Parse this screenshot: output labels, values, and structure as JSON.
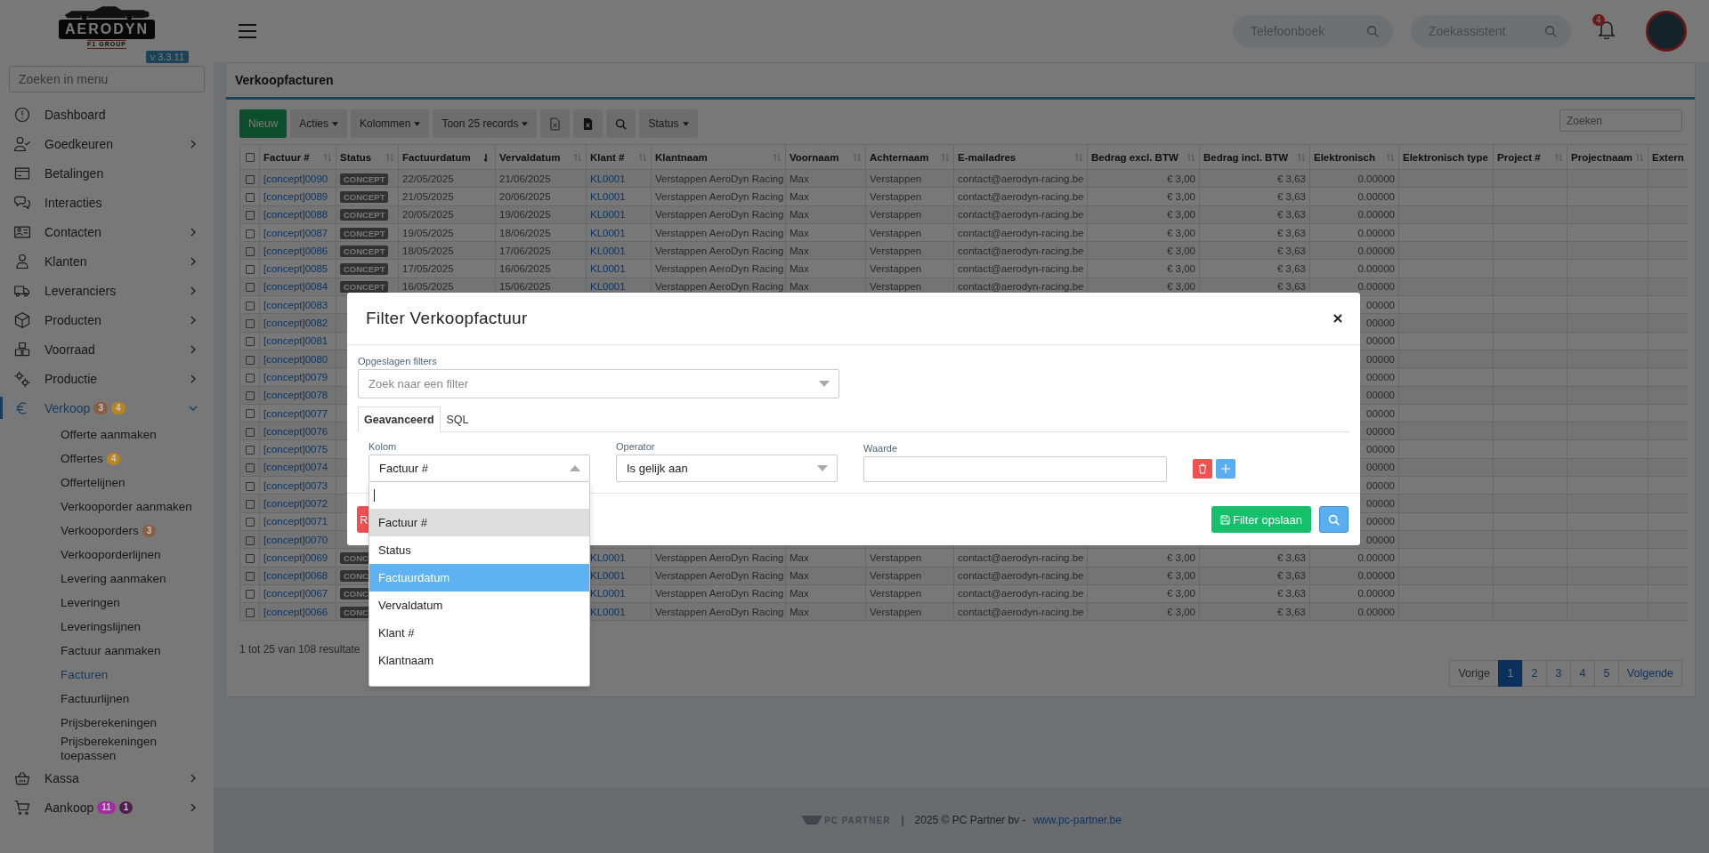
{
  "sidebar": {
    "logo": {
      "name": "AERODYN",
      "tagline": "F1 GROUP"
    },
    "version": "v 3.3.11",
    "search": {
      "placeholder": "Zoeken in menu"
    },
    "items": [
      {
        "label": "Dashboard",
        "selected": false
      },
      {
        "label": "Goedkeuren",
        "expanded": false,
        "selected": false
      },
      {
        "label": "Betalingen",
        "selected": false
      },
      {
        "label": "Interacties",
        "selected": false
      },
      {
        "label": "Contacten",
        "expanded": false,
        "selected": false
      },
      {
        "label": "Klanten",
        "expanded": false,
        "selected": false
      },
      {
        "label": "Leveranciers",
        "expanded": false,
        "selected": false
      },
      {
        "label": "Producten",
        "expanded": false,
        "selected": false
      },
      {
        "label": "Voorraad",
        "expanded": false,
        "selected": false
      },
      {
        "label": "Productie",
        "expanded": false,
        "selected": false
      },
      {
        "label": "Verkoop",
        "expanded": true,
        "selected": true,
        "badges": [
          {
            "text": "3",
            "color": "#8a5e44"
          },
          {
            "text": "4",
            "color": "#b8861e"
          }
        ],
        "children": [
          {
            "label": "Offerte aanmaken",
            "selected": false
          },
          {
            "label": "Offertes",
            "selected": false,
            "badges": [
              {
                "text": "4",
                "color": "#b8861e"
              }
            ]
          },
          {
            "label": "Offertelijnen",
            "selected": false
          },
          {
            "label": "Verkooporder aanmaken",
            "selected": false
          },
          {
            "label": "Verkooporders",
            "selected": false,
            "badges": [
              {
                "text": "3",
                "color": "#8a5e44"
              }
            ]
          },
          {
            "label": "Verkooporderlijnen",
            "selected": false
          },
          {
            "label": "Levering aanmaken",
            "selected": false
          },
          {
            "label": "Leveringen",
            "selected": false
          },
          {
            "label": "Leveringslijnen",
            "selected": false
          },
          {
            "label": "Factuur aanmaken",
            "selected": false
          },
          {
            "label": "Facturen",
            "selected": true
          },
          {
            "label": "Factuurlijnen",
            "selected": false
          },
          {
            "label": "Prijsberekeningen",
            "selected": false
          },
          {
            "label": "Prijsberekeningen toepassen",
            "selected": false
          }
        ]
      },
      {
        "label": "Kassa",
        "expanded": false,
        "selected": false
      },
      {
        "label": "Aankoop",
        "expanded": false,
        "selected": false,
        "badges": [
          {
            "text": "11",
            "color": "#a32ca3"
          },
          {
            "text": "1",
            "color": "#4d1f4d"
          }
        ]
      }
    ]
  },
  "topbar": {
    "phonebook": {
      "placeholder": "Telefoonboek"
    },
    "assistant": {
      "placeholder": "Zoekassistent"
    },
    "notifications": {
      "count": "4"
    }
  },
  "card": {
    "title": "Verkoopfacturen",
    "toolbar": [
      {
        "kind": "primary",
        "label": "Nieuw"
      },
      {
        "kind": "dropdown",
        "label": "Acties"
      },
      {
        "kind": "dropdown",
        "label": "Kolommen"
      },
      {
        "kind": "dropdown",
        "label": "Toon 25 records"
      },
      {
        "kind": "excel"
      },
      {
        "kind": "export"
      },
      {
        "kind": "search"
      },
      {
        "kind": "dropdown",
        "label": "Status"
      }
    ],
    "search": {
      "placeholder": "Zoeken"
    },
    "table": {
      "select_all_checked": false,
      "columns": [
        {
          "label": "Factuur #",
          "sortable": true,
          "sorted": false,
          "kind": "link"
        },
        {
          "label": "Status",
          "sortable": true,
          "sorted": false,
          "kind": "badge"
        },
        {
          "label": "Factuurdatum",
          "sortable": true,
          "sorted": true,
          "kind": "text"
        },
        {
          "label": "Vervaldatum",
          "sortable": true,
          "sorted": false,
          "kind": "text"
        },
        {
          "label": "Klant #",
          "sortable": true,
          "sorted": false,
          "kind": "link"
        },
        {
          "label": "Klantnaam",
          "sortable": true,
          "sorted": false,
          "kind": "text"
        },
        {
          "label": "Voornaam",
          "sortable": true,
          "sorted": false,
          "kind": "text"
        },
        {
          "label": "Achternaam",
          "sortable": true,
          "sorted": false,
          "kind": "text"
        },
        {
          "label": "E-mailadres",
          "sortable": true,
          "sorted": false,
          "kind": "text"
        },
        {
          "label": "Bedrag excl. BTW",
          "sortable": true,
          "sorted": false,
          "kind": "number"
        },
        {
          "label": "Bedrag incl. BTW",
          "sortable": true,
          "sorted": false,
          "kind": "number"
        },
        {
          "label": "Elektronisch",
          "sortable": true,
          "sorted": false,
          "kind": "number"
        },
        {
          "label": "Elektronisch type",
          "sortable": false,
          "kind": "text"
        },
        {
          "label": "Project #",
          "sortable": true,
          "sorted": false,
          "kind": "text"
        },
        {
          "label": "Projectnaam",
          "sortable": true,
          "sorted": false,
          "kind": "text"
        },
        {
          "label": "Extern",
          "sortable": false,
          "kind": "text"
        }
      ],
      "rows": [
        {
          "checked": false,
          "nr": "[concept]0090",
          "status": "CONCEPT",
          "datum": "22/05/2025",
          "verval": "21/06/2025",
          "klant": "KL0001",
          "naam": "Verstappen AeroDyn Racing",
          "voornaam": "Max",
          "achternaam": "Verstappen",
          "email": "contact@aerodyn-racing.be",
          "excl": "€ 3,00",
          "incl": "€ 3,63",
          "elek": "0.00000"
        },
        {
          "checked": false,
          "nr": "[concept]0089",
          "status": "CONCEPT",
          "datum": "21/05/2025",
          "verval": "20/06/2025",
          "klant": "KL0001",
          "naam": "Verstappen AeroDyn Racing",
          "voornaam": "Max",
          "achternaam": "Verstappen",
          "email": "contact@aerodyn-racing.be",
          "excl": "€ 3,00",
          "incl": "€ 3,63",
          "elek": "0.00000"
        },
        {
          "checked": false,
          "nr": "[concept]0088",
          "status": "CONCEPT",
          "datum": "20/05/2025",
          "verval": "19/06/2025",
          "klant": "KL0001",
          "naam": "Verstappen AeroDyn Racing",
          "voornaam": "Max",
          "achternaam": "Verstappen",
          "email": "contact@aerodyn-racing.be",
          "excl": "€ 3,00",
          "incl": "€ 3,63",
          "elek": "0.00000"
        },
        {
          "checked": false,
          "nr": "[concept]0087",
          "status": "CONCEPT",
          "datum": "19/05/2025",
          "verval": "18/06/2025",
          "klant": "KL0001",
          "naam": "Verstappen AeroDyn Racing",
          "voornaam": "Max",
          "achternaam": "Verstappen",
          "email": "contact@aerodyn-racing.be",
          "excl": "€ 3,00",
          "incl": "€ 3,63",
          "elek": "0.00000"
        },
        {
          "checked": false,
          "nr": "[concept]0086",
          "status": "CONCEPT",
          "datum": "18/05/2025",
          "verval": "17/06/2025",
          "klant": "KL0001",
          "naam": "Verstappen AeroDyn Racing",
          "voornaam": "Max",
          "achternaam": "Verstappen",
          "email": "contact@aerodyn-racing.be",
          "excl": "€ 3,00",
          "incl": "€ 3,63",
          "elek": "0.00000"
        },
        {
          "checked": false,
          "nr": "[concept]0085",
          "status": "CONCEPT",
          "datum": "17/05/2025",
          "verval": "16/06/2025",
          "klant": "KL0001",
          "naam": "Verstappen AeroDyn Racing",
          "voornaam": "Max",
          "achternaam": "Verstappen",
          "email": "contact@aerodyn-racing.be",
          "excl": "€ 3,00",
          "incl": "€ 3,63",
          "elek": "0.00000"
        },
        {
          "checked": false,
          "nr": "[concept]0084",
          "status": "CONCEPT",
          "datum": "16/05/2025",
          "verval": "15/06/2025",
          "klant": "KL0001",
          "naam": "Verstappen AeroDyn Racing",
          "voornaam": "Max",
          "achternaam": "Verstappen",
          "email": "contact@aerodyn-racing.be",
          "excl": "€ 3,00",
          "incl": "€ 3,63",
          "elek": "0.00000"
        },
        {
          "checked": false,
          "nr": "[concept]0083",
          "elek": "00000"
        },
        {
          "checked": false,
          "nr": "[concept]0082",
          "elek": "00000"
        },
        {
          "checked": false,
          "nr": "[concept]0081",
          "elek": "00000"
        },
        {
          "checked": false,
          "nr": "[concept]0080",
          "elek": "00000"
        },
        {
          "checked": false,
          "nr": "[concept]0079",
          "elek": "00000"
        },
        {
          "checked": false,
          "nr": "[concept]0078",
          "elek": "00000"
        },
        {
          "checked": false,
          "nr": "[concept]0077",
          "elek": "00000"
        },
        {
          "checked": false,
          "nr": "[concept]0076",
          "elek": "00000"
        },
        {
          "checked": false,
          "nr": "[concept]0075",
          "elek": "00000"
        },
        {
          "checked": false,
          "nr": "[concept]0074",
          "elek": "00000"
        },
        {
          "checked": false,
          "nr": "[concept]0073",
          "elek": "00000"
        },
        {
          "checked": false,
          "nr": "[concept]0072",
          "elek": "00000"
        },
        {
          "checked": false,
          "nr": "[concept]0071",
          "elek": "00000"
        },
        {
          "checked": false,
          "nr": "[concept]0070",
          "elek": "00000"
        },
        {
          "checked": false,
          "nr": "[concept]0069",
          "status": "CONC",
          "klant": "KL0001",
          "naam": "Verstappen AeroDyn Racing",
          "voornaam": "Max",
          "achternaam": "Verstappen",
          "email": "contact@aerodyn-racing.be",
          "excl": "€ 3,00",
          "incl": "€ 3,63",
          "elek": "0.00000"
        },
        {
          "checked": false,
          "nr": "[concept]0068",
          "status": "CONC",
          "klant": "KL0001",
          "naam": "Verstappen AeroDyn Racing",
          "voornaam": "Max",
          "achternaam": "Verstappen",
          "email": "contact@aerodyn-racing.be",
          "excl": "€ 3,00",
          "incl": "€ 3,63",
          "elek": "0.00000"
        },
        {
          "checked": false,
          "nr": "[concept]0067",
          "status": "CONC",
          "klant": "KL0001",
          "naam": "Verstappen AeroDyn Racing",
          "voornaam": "Max",
          "achternaam": "Verstappen",
          "email": "contact@aerodyn-racing.be",
          "excl": "€ 3,00",
          "incl": "€ 3,63",
          "elek": "0.00000"
        },
        {
          "checked": false,
          "nr": "[concept]0066",
          "status": "CONC",
          "klant": "KL0001",
          "naam": "Verstappen AeroDyn Racing",
          "voornaam": "Max",
          "achternaam": "Verstappen",
          "email": "contact@aerodyn-racing.be",
          "excl": "€ 3,00",
          "incl": "€ 3,63",
          "elek": "0.00000"
        }
      ]
    },
    "summary": "1 tot 25 van 108 resultate",
    "pagination": [
      {
        "label": "Vorige",
        "selected": false
      },
      {
        "label": "1",
        "selected": true
      },
      {
        "label": "2",
        "selected": false
      },
      {
        "label": "3",
        "selected": false
      },
      {
        "label": "4",
        "selected": false
      },
      {
        "label": "5",
        "selected": false
      },
      {
        "label": "Volgende",
        "selected": false
      }
    ]
  },
  "footer": {
    "logo": "PC PARTNER",
    "separator": "|",
    "text": "2025 © PC Partner bv -",
    "link": "www.pc-partner.be"
  },
  "modal": {
    "title": "Filter Verkoopfactuur",
    "saved_filters": {
      "label": "Opgeslagen filters",
      "placeholder": "Zoek naar een filter"
    },
    "tabs": [
      {
        "label": "Geavanceerd",
        "selected": true
      },
      {
        "label": "SQL",
        "selected": false
      }
    ],
    "rule": {
      "column": {
        "label": "Kolom",
        "value": "Factuur #",
        "open": true
      },
      "operator": {
        "label": "Operator",
        "value": "Is gelijk aan"
      },
      "value": {
        "label": "Waarde"
      }
    },
    "reset_label": "R",
    "save_label": "Filter opslaan",
    "dropdown": [
      {
        "label": "Factuur #",
        "selected": true,
        "highlighted": false
      },
      {
        "label": "Status",
        "selected": false,
        "highlighted": false
      },
      {
        "label": "Factuurdatum",
        "selected": false,
        "highlighted": true
      },
      {
        "label": "Vervaldatum",
        "selected": false,
        "highlighted": false
      },
      {
        "label": "Klant #",
        "selected": false,
        "highlighted": false
      },
      {
        "label": "Klantnaam",
        "selected": false,
        "highlighted": false
      }
    ]
  }
}
